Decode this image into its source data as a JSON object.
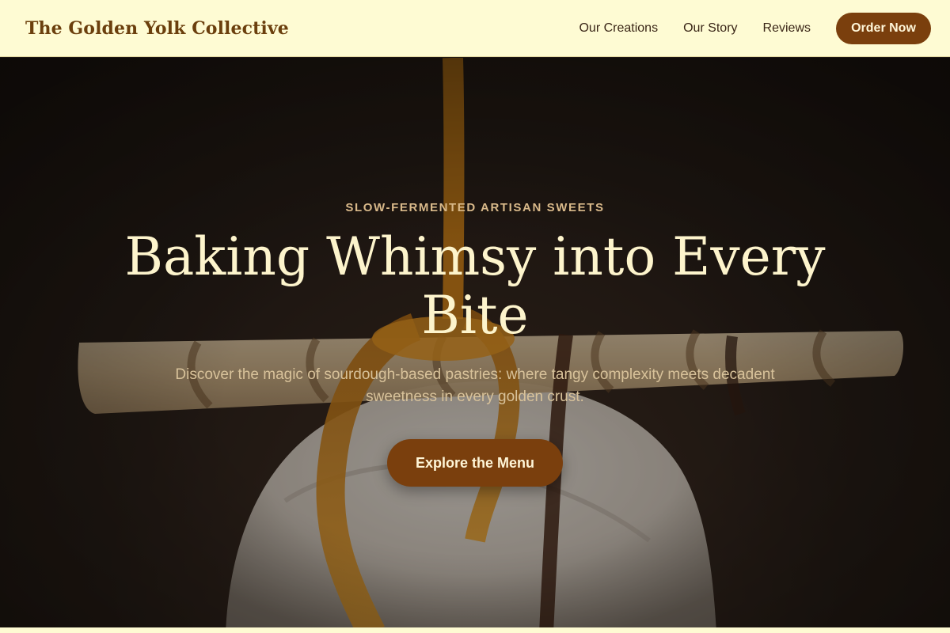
{
  "header": {
    "brand": "The Golden Yolk Collective",
    "nav": [
      "Our Creations",
      "Our Story",
      "Reviews"
    ],
    "cta": "Order Now"
  },
  "hero": {
    "kicker": "SLOW-FERMENTED ARTISAN SWEETS",
    "headline": "Baking Whimsy into Every Bite",
    "subtext": "Discover the magic of sourdough-based pastries: where tangy complexity meets decadent sweetness in every golden crust.",
    "cta": "Explore the Menu",
    "image_alt_icon": "dessert-photo-icon"
  },
  "colors": {
    "header_bg": "#fefbd3",
    "brand": "#6b3f0d",
    "accent": "#7a3f0d",
    "headline": "#fdf4cc",
    "kicker": "#d9b98a"
  }
}
